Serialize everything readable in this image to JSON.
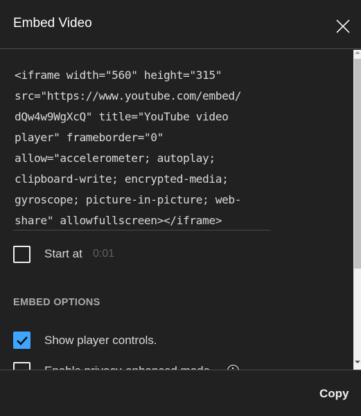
{
  "dialog": {
    "title": "Embed Video",
    "close_icon": "close-icon"
  },
  "embed_code": {
    "lines": [
      "<iframe width=\"560\" height=\"315\"",
      "src=\"https://www.youtube.com/embed/",
      "dQw4w9WgXcQ\" title=\"YouTube video",
      "player\" frameborder=\"0\"",
      "allow=\"accelerometer; autoplay;",
      "clipboard-write; encrypted-media;",
      "gyroscope; picture-in-picture; web-",
      "share\" allowfullscreen></iframe>"
    ]
  },
  "start_at": {
    "label": "Start at",
    "value": "0:01",
    "checked": false
  },
  "embed_options": {
    "heading": "EMBED OPTIONS",
    "options": [
      {
        "label": "Show player controls.",
        "checked": true
      },
      {
        "label": "Enable privacy-enhanced mode.",
        "checked": false,
        "info_icon": "info-icon"
      }
    ]
  },
  "footer": {
    "copy_label": "Copy"
  },
  "colors": {
    "background": "#212121",
    "accent": "#3ea6ff",
    "text": "#f1f1f1",
    "muted": "#aaaaaa"
  }
}
